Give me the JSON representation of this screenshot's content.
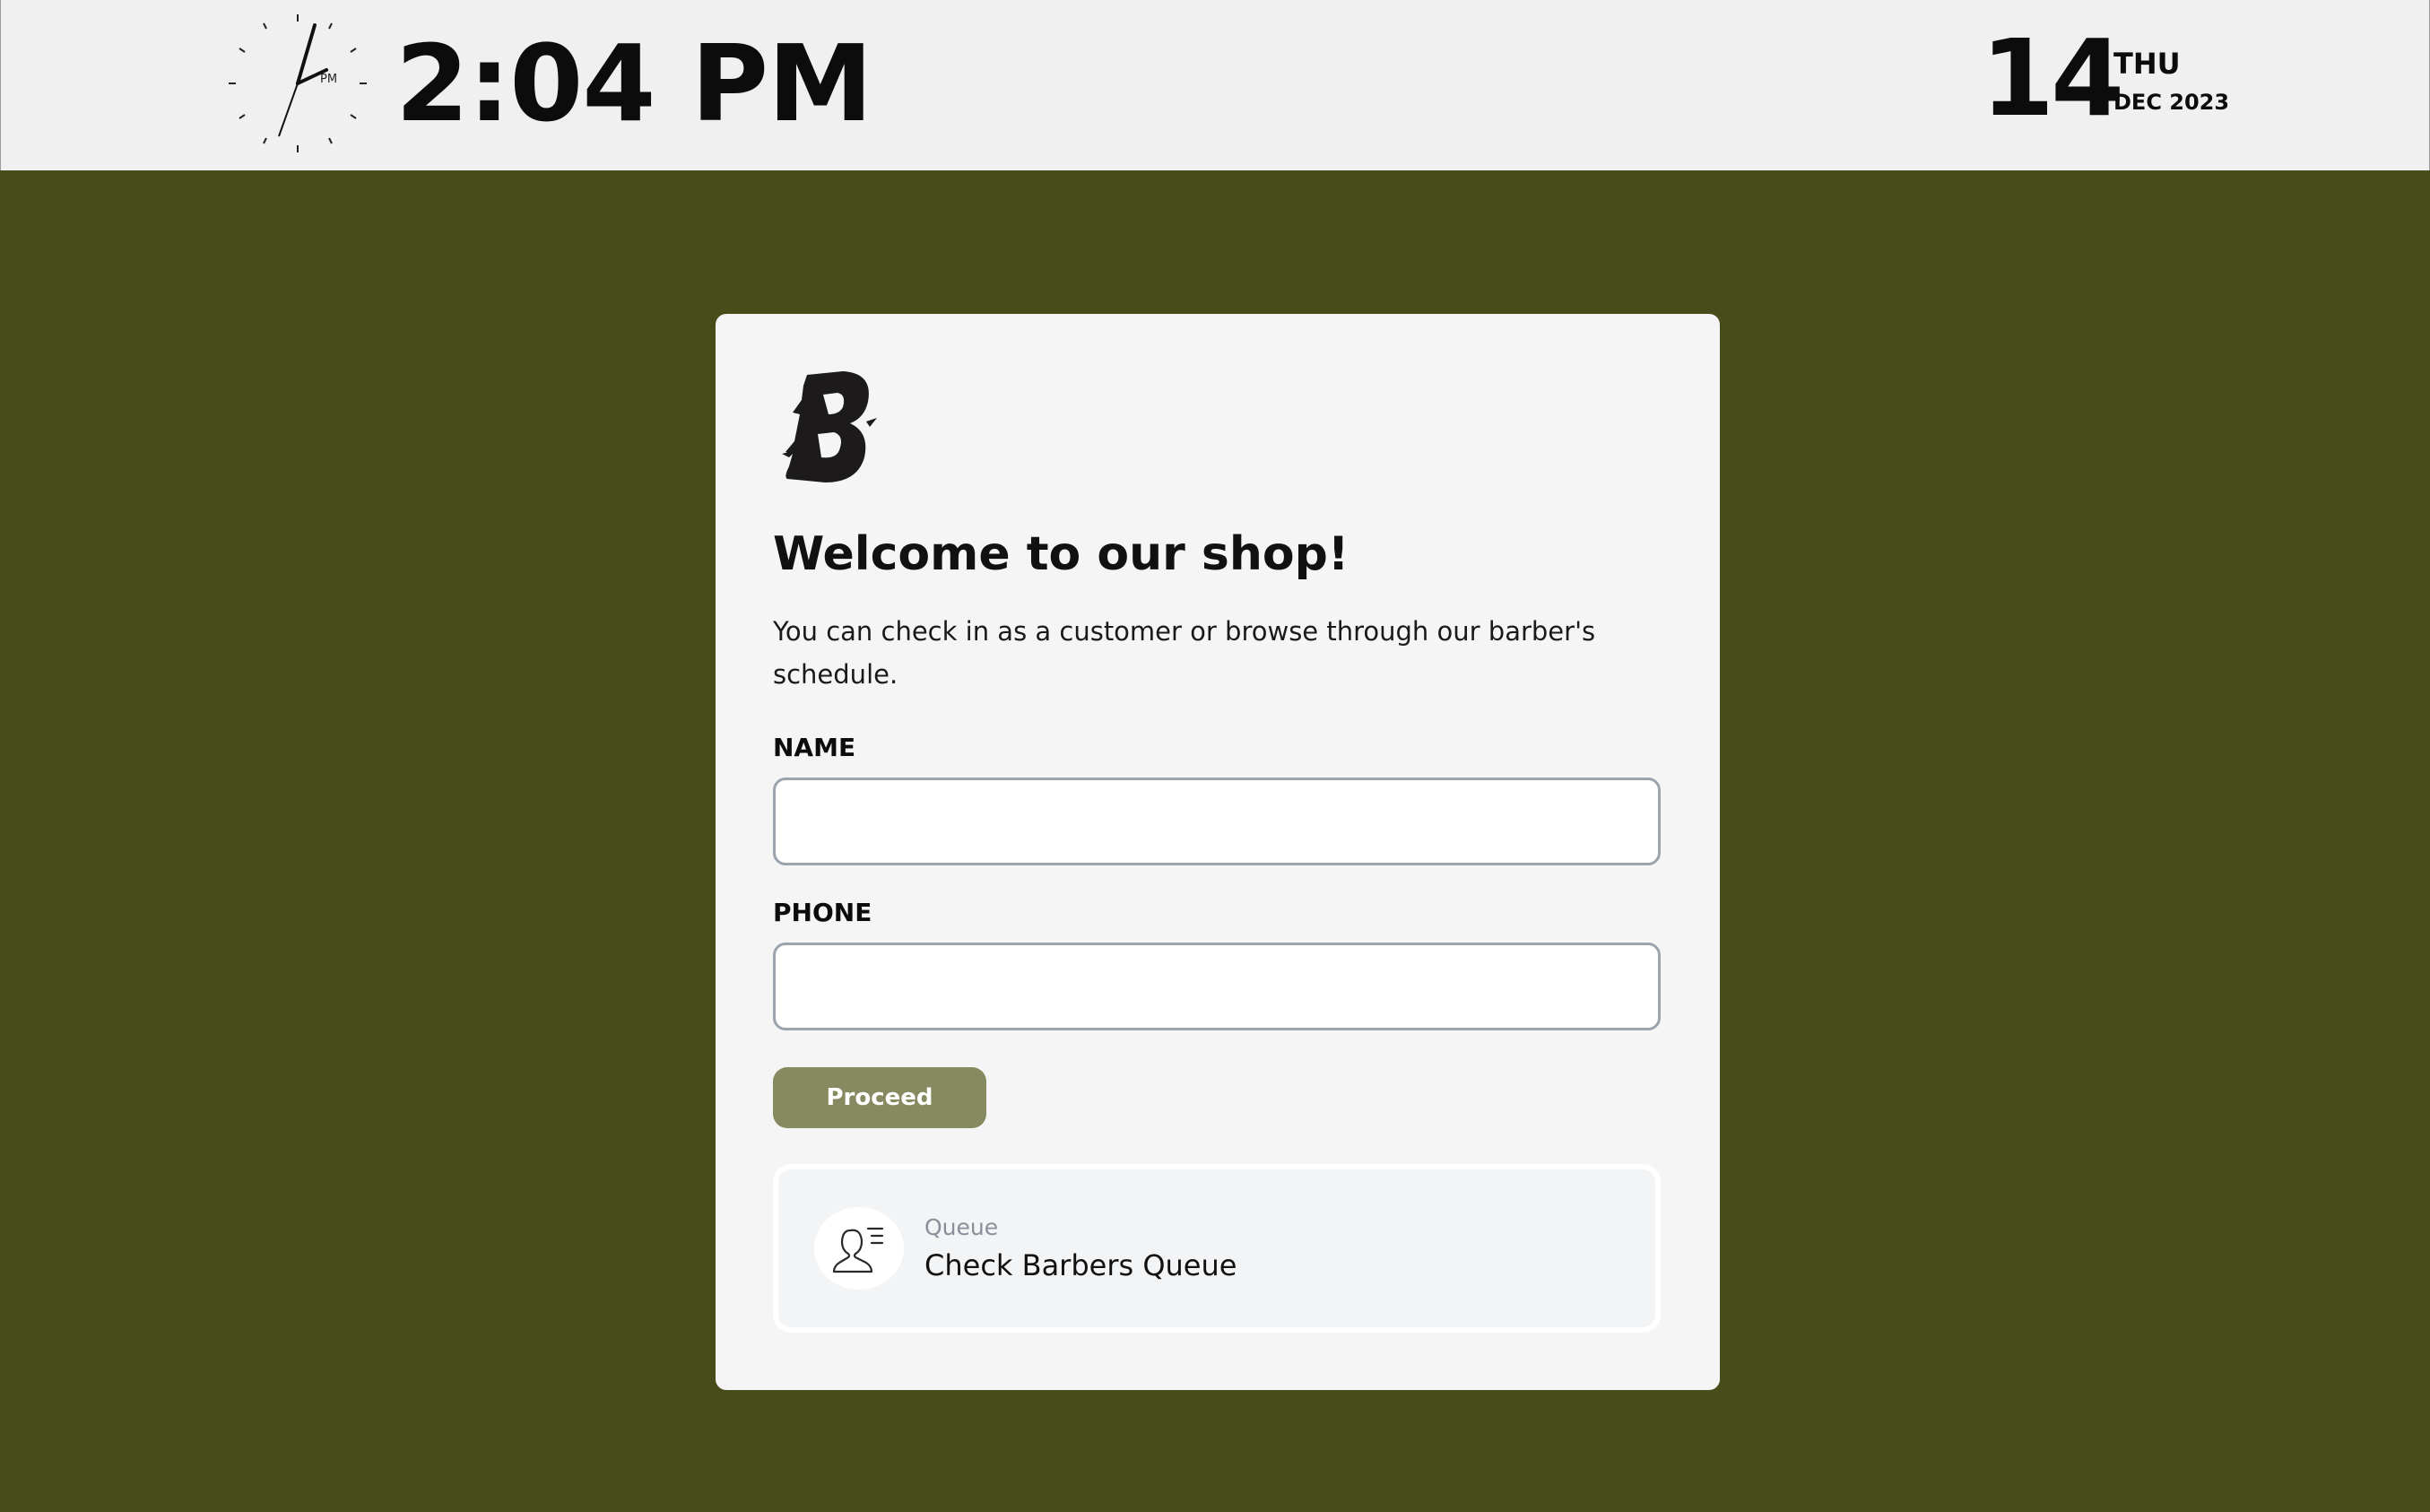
{
  "header": {
    "time": "2:04 PM",
    "clock_meridiem": "PM",
    "date_day": "14",
    "date_weekday": "THU",
    "date_month_year": "DEC 2023"
  },
  "card": {
    "logo_letter": "B",
    "title": "Welcome to our shop!",
    "subtitle": "You can check in as a customer or browse through our barber's schedule.",
    "name_label": "NAME",
    "name_value": "",
    "phone_label": "PHONE",
    "phone_value": "",
    "proceed_label": "Proceed",
    "queue": {
      "small_label": "Queue",
      "title": "Check Barbers Queue",
      "icon": "customer-queue-icon"
    }
  },
  "colors": {
    "background": "#484b1a",
    "header_bg": "#f0f0f0",
    "card_bg": "#f5f5f5",
    "button_bg": "#878a60",
    "input_border": "#9ca3af"
  }
}
